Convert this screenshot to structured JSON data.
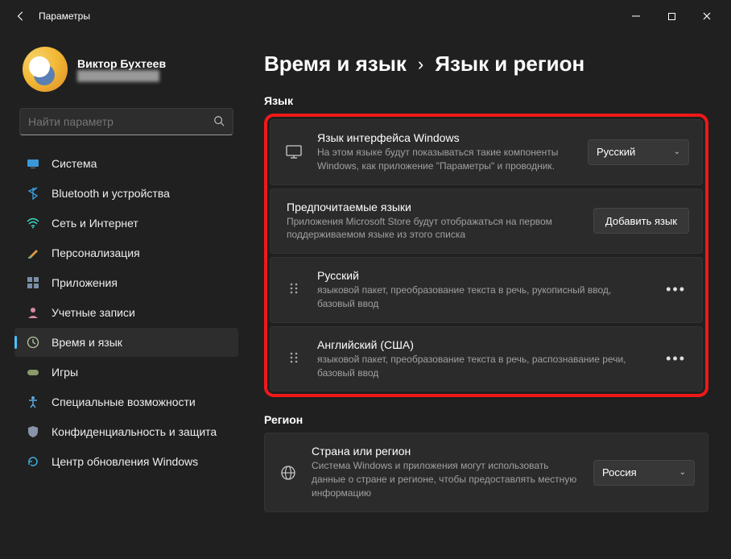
{
  "titlebar": {
    "title": "Параметры"
  },
  "user": {
    "name": "Виктор Бухтеев",
    "email": "████████████"
  },
  "search": {
    "placeholder": "Найти параметр"
  },
  "sidebar": {
    "items": [
      {
        "label": "Система"
      },
      {
        "label": "Bluetooth и устройства"
      },
      {
        "label": "Сеть и Интернет"
      },
      {
        "label": "Персонализация"
      },
      {
        "label": "Приложения"
      },
      {
        "label": "Учетные записи"
      },
      {
        "label": "Время и язык"
      },
      {
        "label": "Игры"
      },
      {
        "label": "Специальные возможности"
      },
      {
        "label": "Конфиденциальность и защита"
      },
      {
        "label": "Центр обновления Windows"
      }
    ]
  },
  "breadcrumb": {
    "parent": "Время и язык",
    "current": "Язык и регион"
  },
  "sections": {
    "language_label": "Язык",
    "region_label": "Регион"
  },
  "lang": {
    "display": {
      "title": "Язык интерфейса Windows",
      "desc": "На этом языке будут показываться такие компоненты Windows, как приложение \"Параметры\" и проводник.",
      "value": "Русский"
    },
    "preferred": {
      "title": "Предпочитаемые языки",
      "desc": "Приложения Microsoft Store будут отображаться на первом поддерживаемом языке из этого списка",
      "add_btn": "Добавить язык"
    },
    "list": [
      {
        "name": "Русский",
        "desc": "языковой пакет, преобразование текста в речь, рукописный ввод, базовый ввод"
      },
      {
        "name": "Английский (США)",
        "desc": "языковой пакет, преобразование текста в речь, распознавание речи, базовый ввод"
      }
    ]
  },
  "region": {
    "country": {
      "title": "Страна или регион",
      "desc": "Система Windows и приложения могут использовать данные о стране и регионе, чтобы предоставлять местную информацию",
      "value": "Россия"
    }
  }
}
